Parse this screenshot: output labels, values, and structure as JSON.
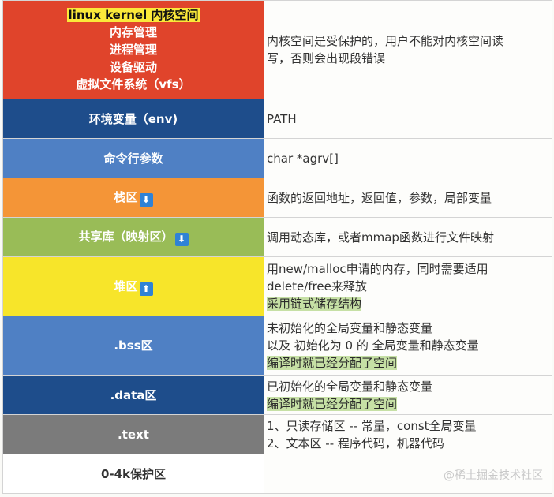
{
  "colors": {
    "kernel": "#e0442b",
    "env": "#1e4d8b",
    "args": "#4f80c4",
    "stack": "#f49537",
    "shared": "#99bc57",
    "heap": "#f7e52a",
    "bss": "#4f80c4",
    "data": "#1e4d8b",
    "text": "#7b7b7b",
    "protect": "#ffffff",
    "highlight_yellow": "#fbe83a",
    "highlight_green": "#c6e0a5",
    "arrow_icon": "#2f82d6"
  },
  "rows": [
    {
      "left": [
        "linux kernel  内核空间",
        "内存管理",
        "进程管理",
        "设备驱动",
        "虚拟文件系统（vfs）"
      ],
      "right": [
        "内核空间是受保护的，用户不能对内核空间读",
        "写，否则会出现段错误"
      ]
    },
    {
      "left": "环境变量（env)",
      "right": "PATH"
    },
    {
      "left": "命令行参数",
      "right": "char *agrv[]"
    },
    {
      "left": "栈区",
      "left_icon": "down-arrow-icon",
      "left_arrow": "⬇",
      "right": "函数的返回地址，返回值，参数，局部变量"
    },
    {
      "left": "共享库（映射区）",
      "left_icon": "down-arrow-icon",
      "left_arrow": "⬇",
      "right": "调用动态库，或者mmap函数进行文件映射"
    },
    {
      "left": "堆区",
      "left_icon": "up-arrow-icon",
      "left_arrow": "⬆",
      "right": [
        "用new/malloc申请的内存，同时需要适用",
        "delete/free来释放",
        "采用链式储存结构"
      ]
    },
    {
      "left": ".bss区",
      "right": [
        "未初始化的全局变量和静态变量",
        "以及 初始化为 0  的 全局变量和静态变量",
        "编译时就已经分配了空间"
      ]
    },
    {
      "left": ".data区",
      "right": [
        "已初始化的全局变量和静态变量",
        "编译时就已经分配了空间"
      ]
    },
    {
      "left": ".text",
      "right": [
        "1、只读存储区 -- 常量，const全局变量",
        "2、文本区 -- 程序代码，机器代码"
      ]
    },
    {
      "left": "0-4k保护区",
      "right": ""
    }
  ],
  "watermark": "@稀土掘金技术社区"
}
